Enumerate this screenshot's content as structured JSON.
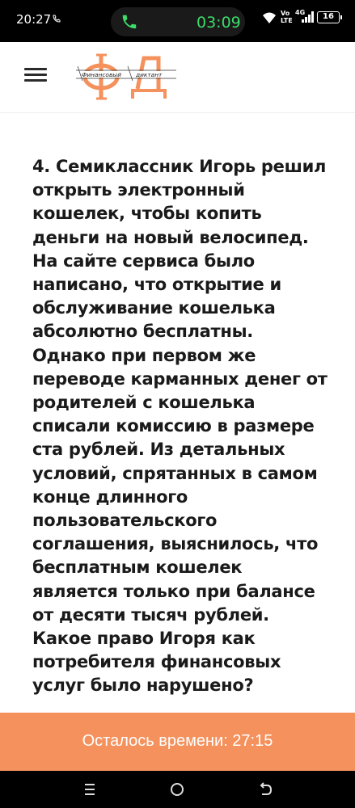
{
  "status_bar": {
    "time": "20:27",
    "call_timer": "03:09",
    "network_top": "Vo",
    "network_bottom": "LTE",
    "network_type": "4G",
    "battery": "16"
  },
  "header": {
    "logo_letters": "ФД",
    "logo_caption_left": "Финансовый",
    "logo_caption_right": "диктант"
  },
  "question": {
    "text": "4. Семиклассник Игорь решил открыть электронный кошелек, чтобы копить деньги на новый велосипед. На сайте сервиса было написано, что открытие и обслуживание кошелька абсолютно бесплатны. Однако при первом же переводе карманных денег от родителей с кошелька списали комиссию в размере ста рублей. Из детальных условий, спрятанных в самом конце длинного пользовательского соглашения, выяснилось, что бесплатным кошелек является только при балансе от десяти тысяч рублей. Какое право Игоря как потребителя финансовых услуг было нарушено?"
  },
  "timer": {
    "label": "Осталось времени: 27:15"
  },
  "colors": {
    "accent": "#f5915c",
    "call_green": "#3ddc6a"
  },
  "icons": {
    "menu": "hamburger-icon",
    "nav_recents": "recents-icon",
    "nav_home": "home-icon",
    "nav_back": "back-icon"
  }
}
